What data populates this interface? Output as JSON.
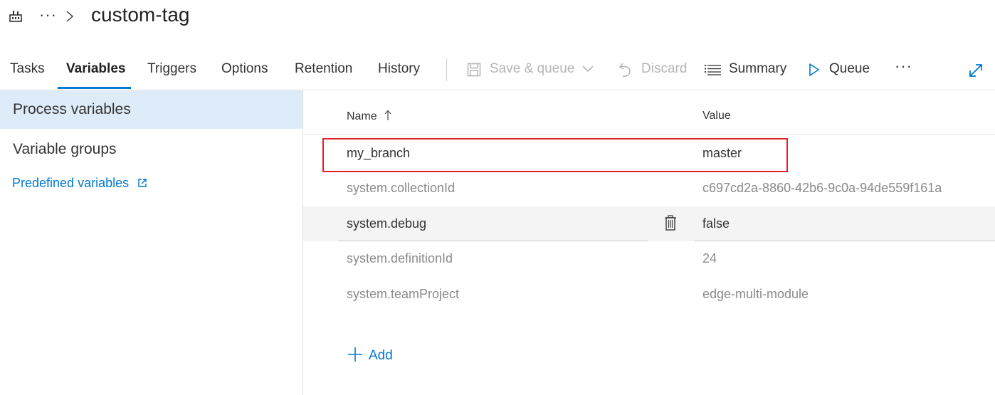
{
  "header": {
    "breadcrumb_more": "···",
    "title": "custom-tag"
  },
  "tabs": [
    {
      "label": "Tasks",
      "active": false
    },
    {
      "label": "Variables",
      "active": true
    },
    {
      "label": "Triggers",
      "active": false
    },
    {
      "label": "Options",
      "active": false
    },
    {
      "label": "Retention",
      "active": false
    },
    {
      "label": "History",
      "active": false
    }
  ],
  "toolbar": {
    "save_queue_label": "Save & queue",
    "discard_label": "Discard",
    "summary_label": "Summary",
    "queue_label": "Queue",
    "more_label": "···"
  },
  "left_nav": {
    "process_variables": "Process variables",
    "variable_groups": "Variable groups",
    "predefined_variables": "Predefined variables"
  },
  "grid": {
    "name_header": "Name",
    "value_header": "Value",
    "rows": [
      {
        "name": "my_branch",
        "value": "master"
      },
      {
        "name": "system.collectionId",
        "value": "c697cd2a-8860-42b6-9c0a-94de559f161a"
      },
      {
        "name": "system.debug",
        "value": "false"
      },
      {
        "name": "system.definitionId",
        "value": "24"
      },
      {
        "name": "system.teamProject",
        "value": "edge-multi-module"
      }
    ],
    "add_label": "Add"
  },
  "colors": {
    "accent": "#0078d4",
    "selected_nav": "#deecf9",
    "highlight": "#e3202a"
  }
}
